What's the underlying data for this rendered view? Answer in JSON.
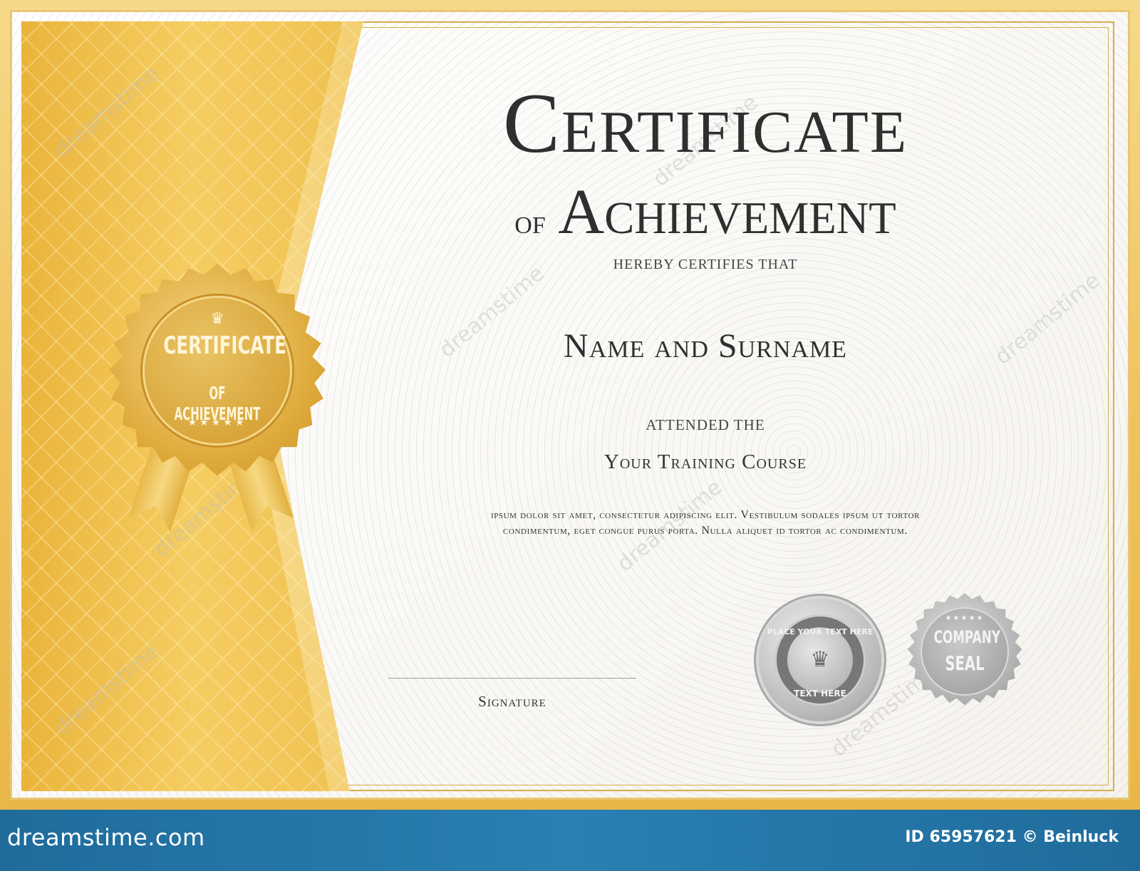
{
  "certificate": {
    "title": "Certificate",
    "subtitle_of": "of",
    "subtitle": "Achievement",
    "certifies": "hereby certifies that",
    "recipient": "Name and Surname",
    "attended": "attended the",
    "course": "Your Training Course",
    "body_line1": "ipsum dolor sit amet, consectetur adipiscing elit. Vestibulum sodales ipsum ut tortor",
    "body_line2": "condimentum, eget congue purus porta. Nulla aliquet id tortor ac condimentum.",
    "signature_label": "Signature"
  },
  "badge": {
    "crown": "♛",
    "title": "CERTIFICATE",
    "subtitle": "OF ACHIEVEMENT",
    "stars": "★★★★★"
  },
  "seals": {
    "text_seal_top": "PLACE YOUR TEXT HERE",
    "text_seal_bottom": "TEXT HERE",
    "text_seal_icon": "♛",
    "company_stars": "★★★★★",
    "company_line1": "COMPANY",
    "company_line2": "SEAL"
  },
  "watermark": {
    "text": "dreamstime"
  },
  "footer": {
    "brand": "dreamstime.com",
    "id_text": "ID 65957621 © Beinluck"
  },
  "colors": {
    "gold": "#efc04f",
    "footer_blue": "#2a7fb3",
    "title_text": "#2f2f2f"
  }
}
